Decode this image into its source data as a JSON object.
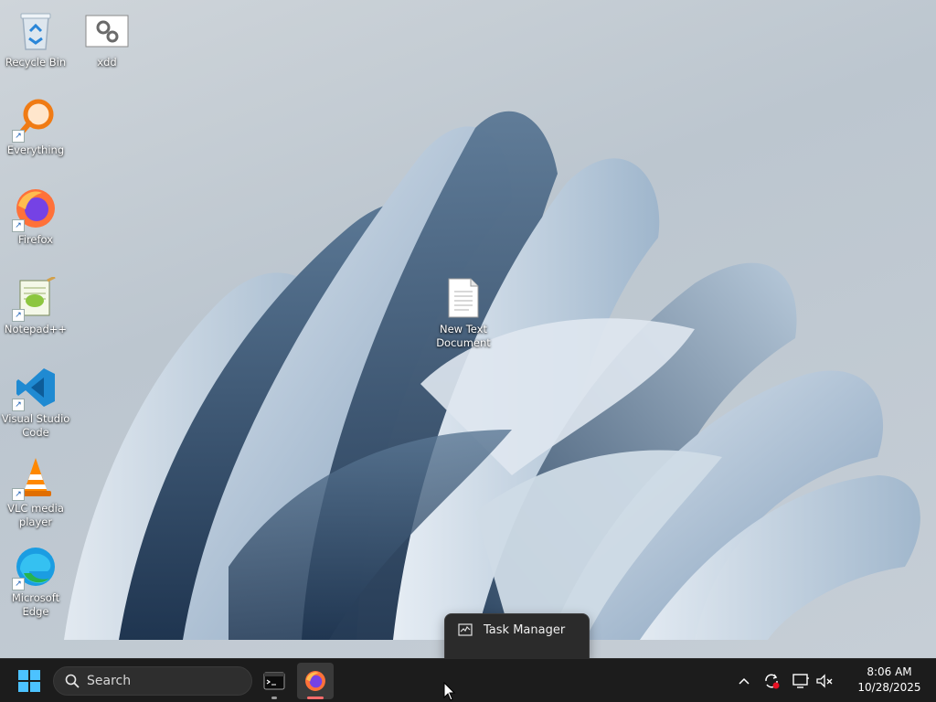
{
  "desktop": {
    "icons": [
      {
        "label": "Recycle Bin",
        "icon": "recycle-bin-icon",
        "shortcut": false
      },
      {
        "label": "xdd",
        "icon": "settings-file-icon",
        "shortcut": false
      },
      {
        "label": "Everything",
        "icon": "magnifier-icon",
        "shortcut": true
      },
      {
        "label": "Firefox",
        "icon": "firefox-icon",
        "shortcut": true
      },
      {
        "label": "Notepad++",
        "icon": "notepadpp-icon",
        "shortcut": true
      },
      {
        "label": "Visual Studio\nCode",
        "icon": "vscode-icon",
        "shortcut": true
      },
      {
        "label": "VLC media\nplayer",
        "icon": "vlc-icon",
        "shortcut": true
      },
      {
        "label": "Microsoft\nEdge",
        "icon": "edge-icon",
        "shortcut": true
      },
      {
        "label": "New Text\nDocument",
        "icon": "text-document-icon",
        "shortcut": false
      }
    ]
  },
  "jump_menu": {
    "items": [
      {
        "label": "Task Manager",
        "icon": "task-manager-icon"
      }
    ]
  },
  "taskbar": {
    "search_placeholder": "Search",
    "apps": [
      {
        "name": "terminal",
        "icon": "terminal-icon",
        "active": false
      },
      {
        "name": "firefox",
        "icon": "firefox-icon",
        "active": true
      }
    ],
    "tray": {
      "icons": [
        "chevron-up-icon",
        "sync-icon",
        "display-icon",
        "speaker-muted-icon"
      ]
    },
    "clock": {
      "time": "8:06 AM",
      "date": "10/28/2025"
    }
  },
  "colors": {
    "taskbar_bg": "#1c1c1c",
    "accent": "#0078d4",
    "firefox_indicator": "#ff6b6b"
  }
}
